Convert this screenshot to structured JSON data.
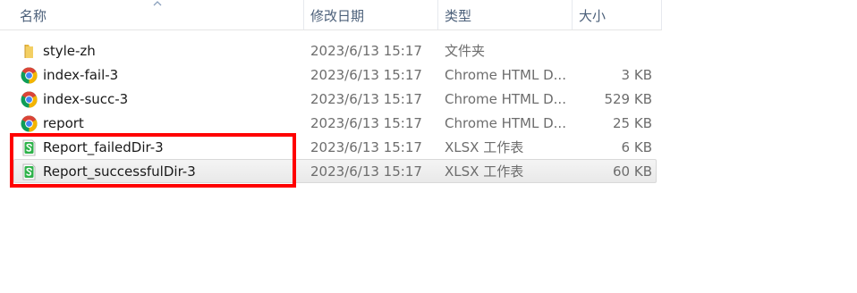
{
  "columns": {
    "name": "名称",
    "date": "修改日期",
    "type": "类型",
    "size": "大小"
  },
  "files": [
    {
      "name": "style-zh",
      "date": "2023/6/13 15:17",
      "type": "文件夹",
      "size": "",
      "icon": "folder-icon"
    },
    {
      "name": "index-fail-3",
      "date": "2023/6/13 15:17",
      "type": "Chrome HTML D...",
      "size": "3 KB",
      "icon": "chrome-icon"
    },
    {
      "name": "index-succ-3",
      "date": "2023/6/13 15:17",
      "type": "Chrome HTML D...",
      "size": "529 KB",
      "icon": "chrome-icon"
    },
    {
      "name": "report",
      "date": "2023/6/13 15:17",
      "type": "Chrome HTML D...",
      "size": "25 KB",
      "icon": "chrome-icon"
    },
    {
      "name": "Report_failedDir-3",
      "date": "2023/6/13 15:17",
      "type": "XLSX 工作表",
      "size": "6 KB",
      "icon": "xlsx-icon"
    },
    {
      "name": "Report_successfulDir-3",
      "date": "2023/6/13 15:17",
      "type": "XLSX 工作表",
      "size": "60 KB",
      "icon": "xlsx-icon"
    }
  ],
  "colors": {
    "header_text": "#4c607a",
    "highlight_border": "#ff0000",
    "chrome_red": "#db4437",
    "chrome_green": "#0f9d58",
    "chrome_yellow": "#f4b400",
    "chrome_blue": "#4285f4",
    "xlsx_green": "#2eb24a",
    "folder_yellow": "#e8b73c"
  }
}
